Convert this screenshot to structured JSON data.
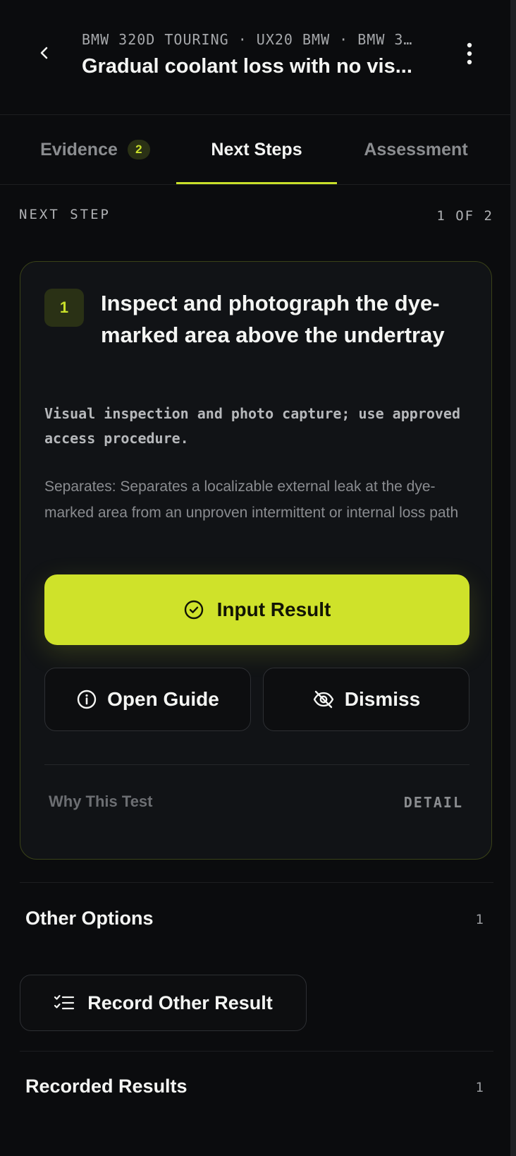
{
  "header": {
    "breadcrumb": "BMW 320D TOURING · UX20 BMW · BMW 3…",
    "title": "Gradual coolant loss with no vis..."
  },
  "tabs": [
    {
      "label": "Evidence",
      "badge": "2"
    },
    {
      "label": "Next Steps"
    },
    {
      "label": "Assessment"
    }
  ],
  "next_step": {
    "section_label": "NEXT STEP",
    "count": "1 OF 2",
    "card": {
      "number": "1",
      "title": "Inspect and photograph the dye-marked area above the undertray",
      "description": "Visual inspection and photo capture; use approved access procedure.",
      "separates": "Separates: Separates a localizable external leak at the dye-marked area from an unproven intermittent or internal loss path",
      "primary_button": "Input Result",
      "guide_button": "Open Guide",
      "dismiss_button": "Dismiss",
      "why_label": "Why This Test",
      "detail_label": "DETAIL"
    }
  },
  "other_options": {
    "title": "Other Options",
    "count": "1",
    "button": "Record Other Result"
  },
  "recorded_results": {
    "title": "Recorded Results",
    "count": "1"
  },
  "colors": {
    "background": "#0b0c0e",
    "accent": "#c9e02a",
    "card": "#111316"
  }
}
